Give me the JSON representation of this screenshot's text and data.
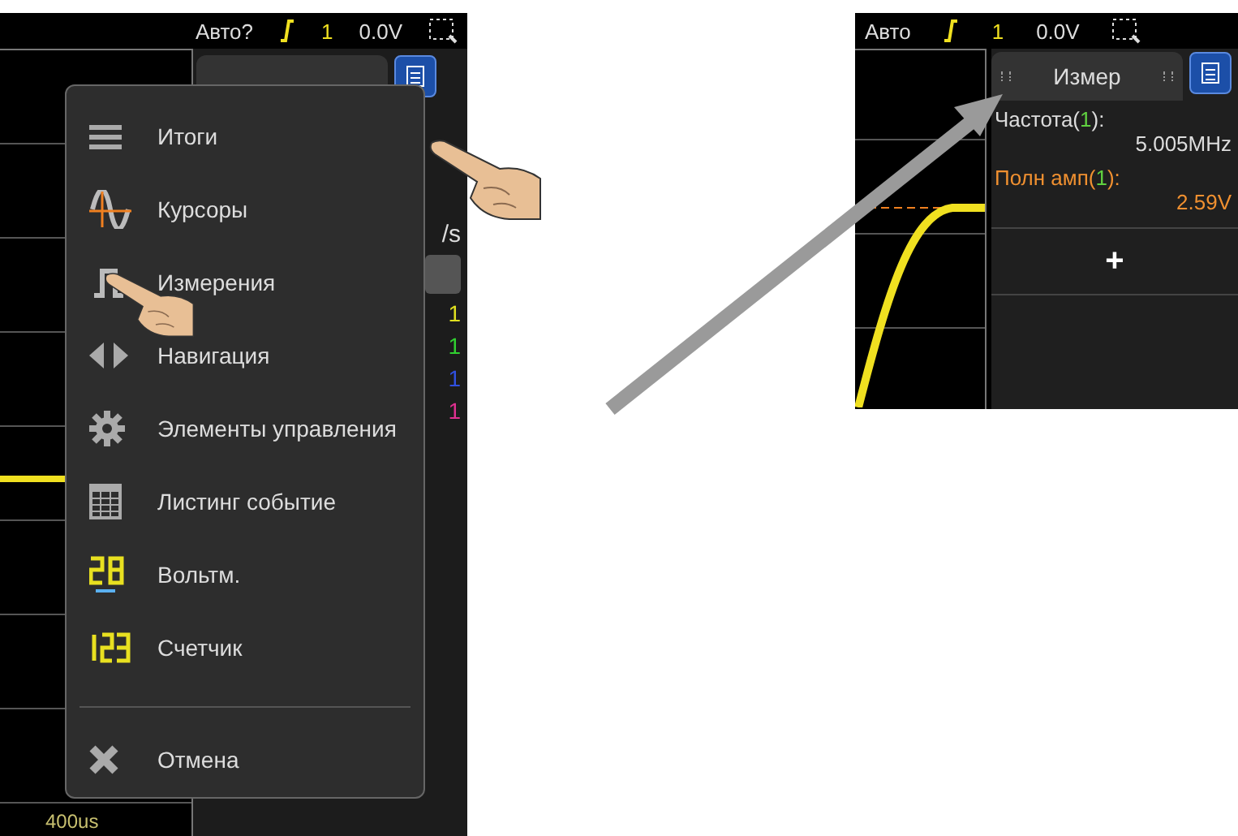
{
  "left_screen": {
    "status_bar": {
      "mode": "Авто?",
      "trigger_channel": "1",
      "trigger_level": "0.0V"
    },
    "side_panel": {
      "rate_unit": "/s",
      "channel_marks": [
        {
          "text": "1",
          "color": "#e0e020"
        },
        {
          "text": "1",
          "color": "#30d030"
        },
        {
          "text": "1",
          "color": "#3050e0"
        },
        {
          "text": "1",
          "color": "#e03090"
        }
      ]
    },
    "timebase": "400us",
    "menu": {
      "items": [
        {
          "label": "Итоги",
          "kind": "lines"
        },
        {
          "label": "Курсоры",
          "kind": "cursors"
        },
        {
          "label": "Измерения",
          "kind": "measure"
        },
        {
          "label": "Навигация",
          "kind": "navigate"
        },
        {
          "label": "Элементы управления",
          "kind": "gear"
        },
        {
          "label": "Листинг событие",
          "kind": "table"
        },
        {
          "label": "Вольтм.",
          "kind": "voltmeter"
        },
        {
          "label": "Счетчик",
          "kind": "counter"
        }
      ],
      "cancel": {
        "label": "Отмена"
      }
    }
  },
  "right_screen": {
    "status_bar": {
      "mode": "Авто",
      "trigger_channel": "1",
      "trigger_level": "0.0V"
    },
    "tab": {
      "label": "Измер"
    },
    "measurements": [
      {
        "name": "Частота(",
        "channel": "1",
        "suffix": "):",
        "value": "5.005MHz",
        "selected": false
      },
      {
        "name": "Полн амп(",
        "channel": "1",
        "suffix": "):",
        "value": "2.59V",
        "selected": true
      }
    ],
    "add_button": "+"
  }
}
